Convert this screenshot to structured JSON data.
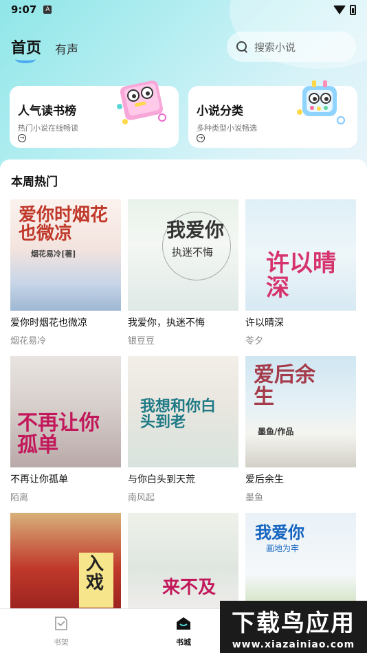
{
  "status_bar": {
    "time": "9:07",
    "notification_letter": "A"
  },
  "header": {
    "tab_home": "首页",
    "tab_audio": "有声",
    "search_placeholder": "搜索小说"
  },
  "feature_cards": [
    {
      "title": "人气读书榜",
      "subtitle": "热门小说在线畅读"
    },
    {
      "title": "小说分类",
      "subtitle": "多种类型小说畅选"
    }
  ],
  "section_title": "本周热门",
  "books": [
    {
      "title": "爱你时烟花也微凉",
      "author": "烟花易冷",
      "cover_text": "爱你时烟花也微凉",
      "cover_sub": "烟花易冷[著]",
      "accent": "#c0392b"
    },
    {
      "title": "我爱你，执迷不悔",
      "author": "银豆豆",
      "cover_text": "我爱你",
      "cover_sub": "执迷不悔",
      "accent": "#333333"
    },
    {
      "title": "许以晴深",
      "author": "苓夕",
      "cover_text": "许以晴深",
      "cover_sub": "",
      "accent": "#d6336c"
    },
    {
      "title": "不再让你孤单",
      "author": "陌离",
      "cover_text": "不再让你孤单",
      "cover_sub": "",
      "accent": "#c2185b"
    },
    {
      "title": "与你白头到天荒",
      "author": "南风起",
      "cover_text": "我想和你白头到老",
      "cover_sub": "",
      "accent": "#1f7a86"
    },
    {
      "title": "爱后余生",
      "author": "墨鱼",
      "cover_text": "爱后余生",
      "cover_sub": "墨鱼/作品",
      "accent": "#a53a4a"
    },
    {
      "title": "",
      "author": "",
      "cover_text": "入戏",
      "cover_sub": "",
      "accent": "#222222"
    },
    {
      "title": "",
      "author": "",
      "cover_text": "来不及",
      "cover_sub": "",
      "accent": "#c2185b"
    },
    {
      "title": "",
      "author": "",
      "cover_text": "我爱你",
      "cover_sub": "画地为牢",
      "accent": "#1565c0"
    }
  ],
  "bottom_nav": [
    {
      "label": "书架",
      "icon": "bookshelf-icon",
      "active": false
    },
    {
      "label": "书城",
      "icon": "bookstore-icon",
      "active": true
    },
    {
      "label": "",
      "icon": "",
      "active": false
    }
  ],
  "watermark": {
    "main": "下载鸟应用",
    "url": "www.xiazainiao.com"
  }
}
